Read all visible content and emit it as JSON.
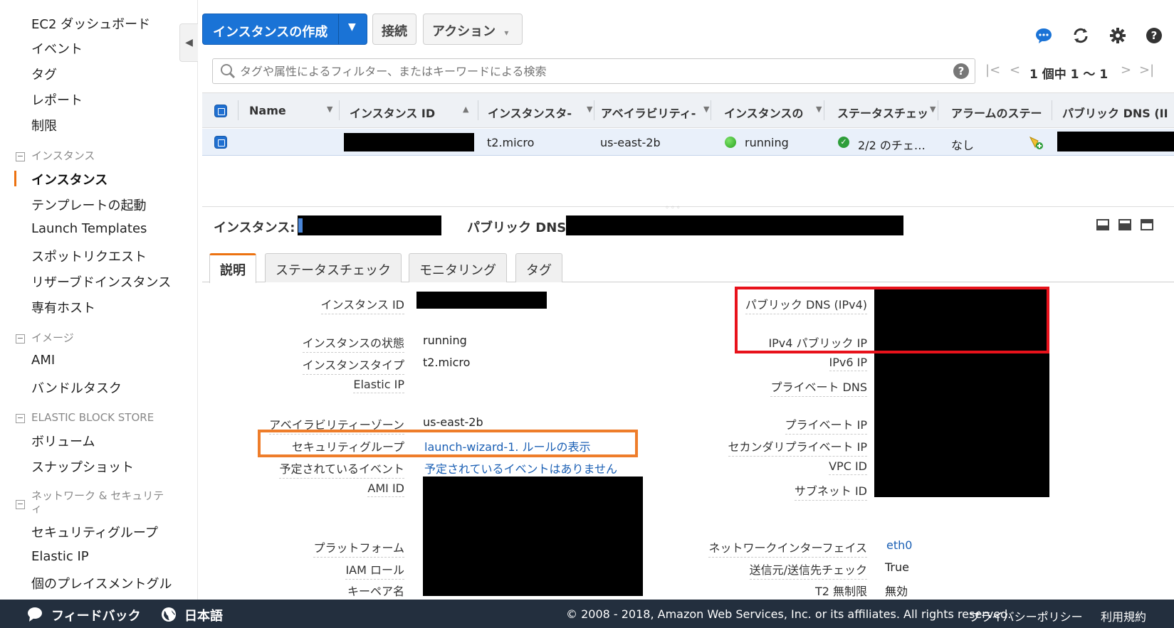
{
  "sidebar": {
    "items": [
      {
        "label": "EC2 ダッシュボード"
      },
      {
        "label": "イベント"
      },
      {
        "label": "タグ"
      },
      {
        "label": "レポート"
      },
      {
        "label": "制限"
      }
    ],
    "sections": [
      {
        "title": "インスタンス",
        "items": [
          "インスタンス",
          "テンプレートの起動",
          "Launch Templates",
          "スポットリクエスト",
          "リザーブドインスタンス",
          "専有ホスト"
        ]
      },
      {
        "title": "イメージ",
        "items": [
          "AMI",
          "バンドルタスク"
        ]
      },
      {
        "title": "ELASTIC BLOCK STORE",
        "items": [
          "ボリューム",
          "スナップショット"
        ]
      },
      {
        "title": "ネットワーク & セキュリティ",
        "items": [
          "セキュリティグループ",
          "Elastic IP",
          "個のプレイスメントグル"
        ]
      }
    ],
    "active_item": "インスタンス"
  },
  "toolbar": {
    "launch_label": "インスタンスの作成",
    "connect_label": "接続",
    "actions_label": "アクション"
  },
  "search": {
    "placeholder": "タグや属性によるフィルター、またはキーワードによる検索"
  },
  "pager": {
    "label": "1 個中 1 〜 1"
  },
  "table": {
    "columns": [
      "Name",
      "インスタンス ID",
      "インスタンスタ‐",
      "アベイラビリティ‐",
      "インスタンスの",
      "ステータスチェッ",
      "アラームのステー",
      "パブリック DNS (II"
    ],
    "row": {
      "instance_type": "t2.micro",
      "availability_zone": "us-east-2b",
      "state": "running",
      "status_checks": "2/2 のチェ…",
      "alarm": "なし"
    }
  },
  "detail": {
    "instance_label": "インスタンス:",
    "public_dns_label": "パブリック DNS:",
    "tabs": [
      "説明",
      "ステータスチェック",
      "モニタリング",
      "タグ"
    ],
    "left": [
      {
        "label": "インスタンス ID",
        "value": ""
      },
      {
        "label": "インスタンスの状態",
        "value": "running"
      },
      {
        "label": "インスタンスタイプ",
        "value": "t2.micro"
      },
      {
        "label": "Elastic IP",
        "value": ""
      },
      {
        "label": "アベイラビリティーゾーン",
        "value": "us-east-2b"
      },
      {
        "label": "セキュリティグループ",
        "value": "launch-wizard-1. ルールの表示"
      },
      {
        "label": "予定されているイベント",
        "value": "予定されているイベントはありません"
      },
      {
        "label": "AMI ID",
        "value": ""
      },
      {
        "label": "プラットフォーム",
        "value": ""
      },
      {
        "label": "IAM ロール",
        "value": ""
      },
      {
        "label": "キーペア名",
        "value": ""
      }
    ],
    "right": [
      {
        "label": "パブリック DNS (IPv4)",
        "value": ""
      },
      {
        "label": "IPv4 パブリック IP",
        "value": ""
      },
      {
        "label": "IPv6 IP",
        "value": ""
      },
      {
        "label": "プライベート DNS",
        "value": ""
      },
      {
        "label": "プライベート IP",
        "value": ""
      },
      {
        "label": "セカンダリプライベート IP",
        "value": ""
      },
      {
        "label": "VPC ID",
        "value": ""
      },
      {
        "label": "サブネット ID",
        "value": ""
      },
      {
        "label": "ネットワークインターフェイス",
        "value": "eth0"
      },
      {
        "label": "送信元/送信先チェック",
        "value": "True"
      },
      {
        "label": "T2 無制限",
        "value": "無効"
      }
    ]
  },
  "footer": {
    "feedback": "フィードバック",
    "language": "日本語",
    "copyright": "© 2008 - 2018, Amazon Web Services, Inc. or its affiliates. All rights reserved.",
    "privacy": "プライバシーポリシー",
    "terms": "利用規約"
  },
  "colors": {
    "accent": "#1a73d6",
    "active_marker": "#ec7211",
    "highlight_red": "#e8121b",
    "highlight_orange": "#ee7d2a",
    "footer_bg": "#232f3e",
    "link": "#1a5fb4"
  }
}
